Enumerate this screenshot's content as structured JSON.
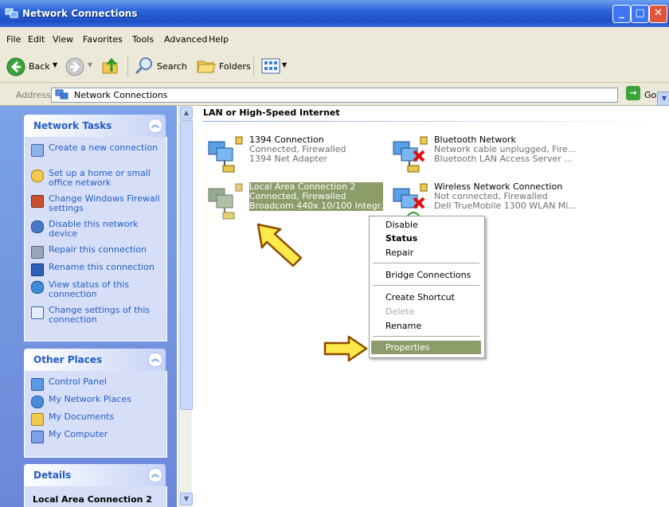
{
  "window": {
    "title": "Network Connections"
  },
  "menu": [
    "File",
    "Edit",
    "View",
    "Favorites",
    "Tools",
    "Advanced",
    "Help"
  ],
  "toolbar": {
    "back": "Back",
    "search": "Search",
    "folders": "Folders"
  },
  "address": {
    "label": "Address",
    "value": "Network Connections",
    "go": "Go"
  },
  "tasks_panel": {
    "title": "Network Tasks",
    "items": [
      {
        "label": "Create a new connection",
        "icon": "new-connection-icon"
      },
      {
        "label": "Set up a home or small office network",
        "icon": "home-network-icon"
      },
      {
        "label": "Change Windows Firewall settings",
        "icon": "firewall-icon"
      },
      {
        "label": "Disable this network device",
        "icon": "disable-icon"
      },
      {
        "label": "Repair this connection",
        "icon": "repair-icon"
      },
      {
        "label": "Rename this connection",
        "icon": "rename-icon"
      },
      {
        "label": "View status of this connection",
        "icon": "status-icon"
      },
      {
        "label": "Change settings of this connection",
        "icon": "settings-icon"
      }
    ]
  },
  "places_panel": {
    "title": "Other Places",
    "items": [
      {
        "label": "Control Panel",
        "icon": "control-panel-icon"
      },
      {
        "label": "My Network Places",
        "icon": "network-places-icon"
      },
      {
        "label": "My Documents",
        "icon": "documents-icon"
      },
      {
        "label": "My Computer",
        "icon": "computer-icon"
      }
    ]
  },
  "details_panel": {
    "title": "Details",
    "selected": "Local Area Connection 2"
  },
  "group_header": "LAN or High-Speed Internet",
  "connections": [
    {
      "name": "1394 Connection",
      "status": "Connected, Firewalled",
      "device": "1394 Net Adapter"
    },
    {
      "name": "Bluetooth Network",
      "status": "Network cable unplugged, Fire...",
      "device": "Bluetooth LAN Access Server ..."
    },
    {
      "name": "Local Area Connection 2",
      "status": "Connected, Firewalled",
      "device": "Broadcom 440x 10/100 Integr..."
    },
    {
      "name": "Wireless Network Connection",
      "status": "Not connected, Firewalled",
      "device": "Dell TrueMobile 1300 WLAN Mi..."
    }
  ],
  "context_menu": {
    "disable": "Disable",
    "status": "Status",
    "repair": "Repair",
    "bridge": "Bridge Connections",
    "shortcut": "Create Shortcut",
    "delete": "Delete",
    "rename": "Rename",
    "properties": "Properties"
  },
  "colors": {
    "title_bar": "#2b63d8",
    "selection": "#8c9d6a",
    "task_link": "#215dc6",
    "arrow": "#ffe84a"
  }
}
